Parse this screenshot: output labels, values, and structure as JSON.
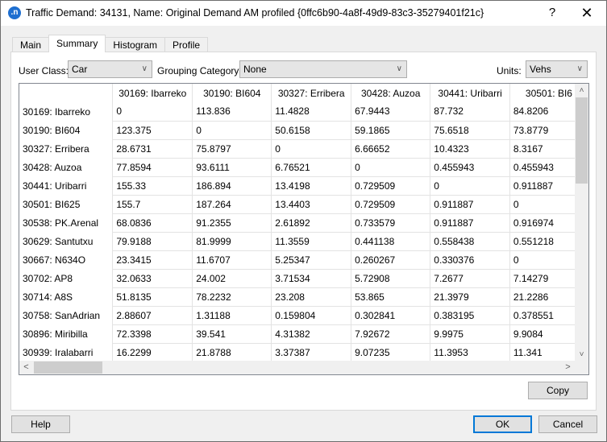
{
  "window": {
    "title": "Traffic Demand: 34131, Name: Original Demand AM profiled  {0ffc6b90-4a8f-49d9-83c3-35279401f21c}",
    "app_icon": ".n",
    "help_glyph": "?",
    "close_glyph": "✕"
  },
  "tabs": [
    {
      "label": "Main",
      "active": false
    },
    {
      "label": "Summary",
      "active": true
    },
    {
      "label": "Histogram",
      "active": false
    },
    {
      "label": "Profile",
      "active": false
    }
  ],
  "filters": {
    "user_class_label": "User Class:",
    "user_class_value": "Car",
    "grouping_label": "Grouping Category:",
    "grouping_value": "None",
    "units_label": "Units:",
    "units_value": "Vehs"
  },
  "table": {
    "columns": [
      "30169: Ibarreko",
      "30190: BI604",
      "30327: Erribera",
      "30428: Auzoa",
      "30441: Uribarri",
      "30501: BI6"
    ],
    "rows": [
      {
        "label": "30169: Ibarreko",
        "values": [
          "0",
          "113.836",
          "11.4828",
          "67.9443",
          "87.732",
          "84.8206"
        ]
      },
      {
        "label": "30190: BI604",
        "values": [
          "123.375",
          "0",
          "50.6158",
          "59.1865",
          "75.6518",
          "73.8779"
        ]
      },
      {
        "label": "30327: Erribera",
        "values": [
          "28.6731",
          "75.8797",
          "0",
          "6.66652",
          "10.4323",
          "8.3167"
        ]
      },
      {
        "label": "30428: Auzoa",
        "values": [
          "77.8594",
          "93.6111",
          "6.76521",
          "0",
          "0.455943",
          "0.455943"
        ]
      },
      {
        "label": "30441: Uribarri",
        "values": [
          "155.33",
          "186.894",
          "13.4198",
          "0.729509",
          "0",
          "0.911887"
        ]
      },
      {
        "label": "30501: BI625",
        "values": [
          "155.7",
          "187.264",
          "13.4403",
          "0.729509",
          "0.911887",
          "0"
        ]
      },
      {
        "label": "30538: PK.Arenal",
        "values": [
          "68.0836",
          "91.2355",
          "2.61892",
          "0.733579",
          "0.911887",
          "0.916974"
        ]
      },
      {
        "label": "30629: Santutxu",
        "values": [
          "79.9188",
          "81.9999",
          "11.3559",
          "0.441138",
          "0.558438",
          "0.551218"
        ]
      },
      {
        "label": "30667: N634O",
        "values": [
          "23.3415",
          "11.6707",
          "5.25347",
          "0.260267",
          "0.330376",
          "0"
        ]
      },
      {
        "label": "30702: AP8",
        "values": [
          "32.0633",
          "24.002",
          "3.71534",
          "5.72908",
          "7.2677",
          "7.14279"
        ]
      },
      {
        "label": "30714: A8S",
        "values": [
          "51.8135",
          "78.2232",
          "23.208",
          "53.865",
          "21.3979",
          "21.2286"
        ]
      },
      {
        "label": "30758: SanAdrian",
        "values": [
          "2.88607",
          "1.31188",
          "0.159804",
          "0.302841",
          "0.383195",
          "0.378551"
        ]
      },
      {
        "label": "30896: Miribilla",
        "values": [
          "72.3398",
          "39.541",
          "4.31382",
          "7.92672",
          "9.9975",
          "9.9084"
        ]
      },
      {
        "label": "30939: Iralabarri",
        "values": [
          "16.2299",
          "21.8788",
          "3.37387",
          "9.07235",
          "11.3953",
          "11.341"
        ]
      }
    ]
  },
  "scroll_glyphs": {
    "up": "˄",
    "down": "˅",
    "left": "<",
    "right": ">"
  },
  "buttons": {
    "copy": "Copy",
    "help": "Help",
    "ok": "OK",
    "cancel": "Cancel"
  }
}
